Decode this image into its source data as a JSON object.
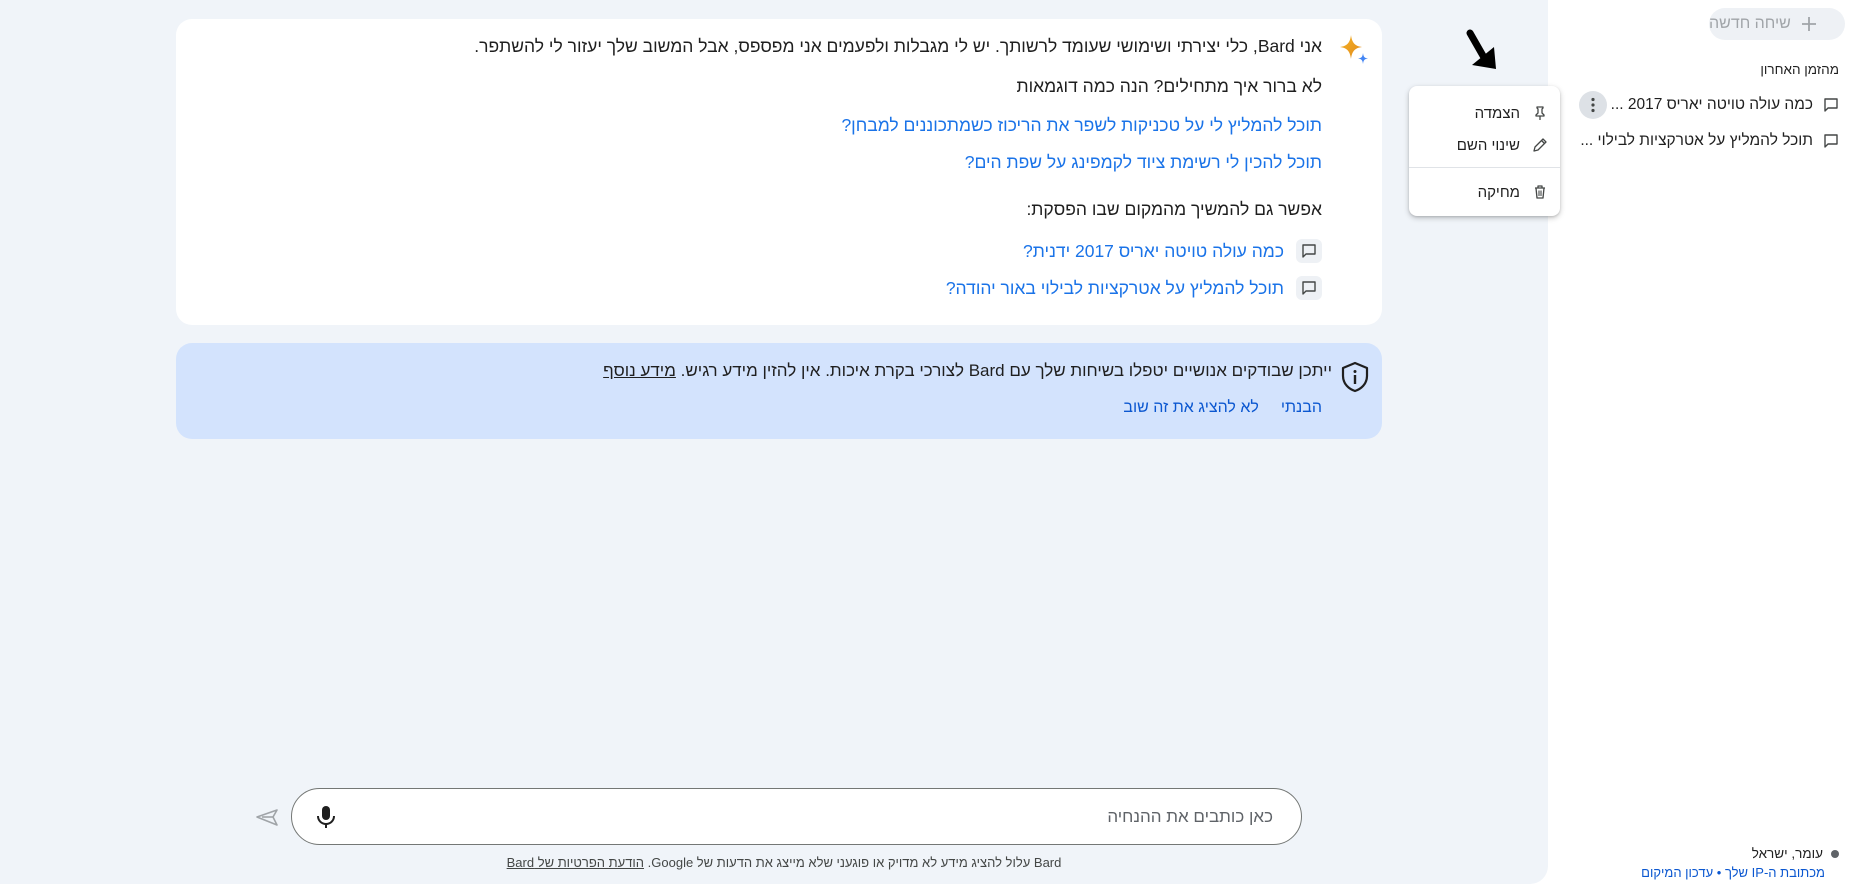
{
  "sidebar": {
    "new_chat_label": "שיחה חדשה",
    "recent_label": "מהזמן האחרון",
    "items": [
      {
        "label": "כמה עולה טויטה יאריס 2017 ..."
      },
      {
        "label": "תוכל להמליץ על אטרקציות לבילוי ..."
      }
    ],
    "location": {
      "place": "עומר, ישראל",
      "source": "מכתובת ה-IP שלך",
      "separator": "•",
      "update": "עדכון המיקום"
    }
  },
  "context_menu": {
    "pin": "הצמדה",
    "rename": "שינוי השם",
    "delete": "מחיקה"
  },
  "welcome": {
    "intro": "אני Bard, כלי יצירתי ושימושי שעומד לרשותך. יש לי מגבלות ולפעמים אני מפספס, אבל המשוב שלך יעזור לי להשתפר.",
    "question_heading": "לא ברור איך מתחילים? הנה כמה דוגמאות",
    "examples": [
      "תוכל להמליץ לי על טכניקות לשפר את הריכוז כשמתכוננים למבחן?",
      "תוכל להכין לי רשימת ציוד לקמפינג על שפת הים?"
    ],
    "continue_heading": "אפשר גם להמשיך מהמקום שבו הפסקת:",
    "recent_chats": [
      "כמה עולה טויטה יאריס 2017 ידנית?",
      "תוכל להמליץ על אטרקציות לבילוי באור יהודה?"
    ]
  },
  "notice": {
    "text": "ייתכן שבודקים אנושיים יטפלו בשיחות שלך עם Bard לצורכי בקרת איכות. אין להזין מידע רגיש.",
    "more_info": "מידע נוסף",
    "got_it": "הבנתי",
    "dont_show": "לא להציג את זה שוב"
  },
  "input": {
    "placeholder": "כאן כותבים את ההנחיה"
  },
  "footer": {
    "disclaimer": "Bard עלול להציג מידע לא מדויק או פוגעני שלא מייצג את הדעות של Google.",
    "privacy_link": "הודעת הפרטיות של Bard"
  },
  "colors": {
    "background": "#f0f4f9",
    "card": "#ffffff",
    "link": "#1a73e8",
    "notice_bg": "#d3e3fd",
    "accent_blue": "#0b57d0"
  },
  "icons": {
    "sparkle": "bard-sparkle-icon",
    "shield": "shield-info-icon",
    "chat": "chat-bubble-icon",
    "mic": "mic-icon",
    "send": "send-icon",
    "plus": "plus-icon",
    "kebab": "more-vert-icon",
    "pin": "pin-icon",
    "pencil": "pencil-icon",
    "trash": "trash-icon"
  }
}
